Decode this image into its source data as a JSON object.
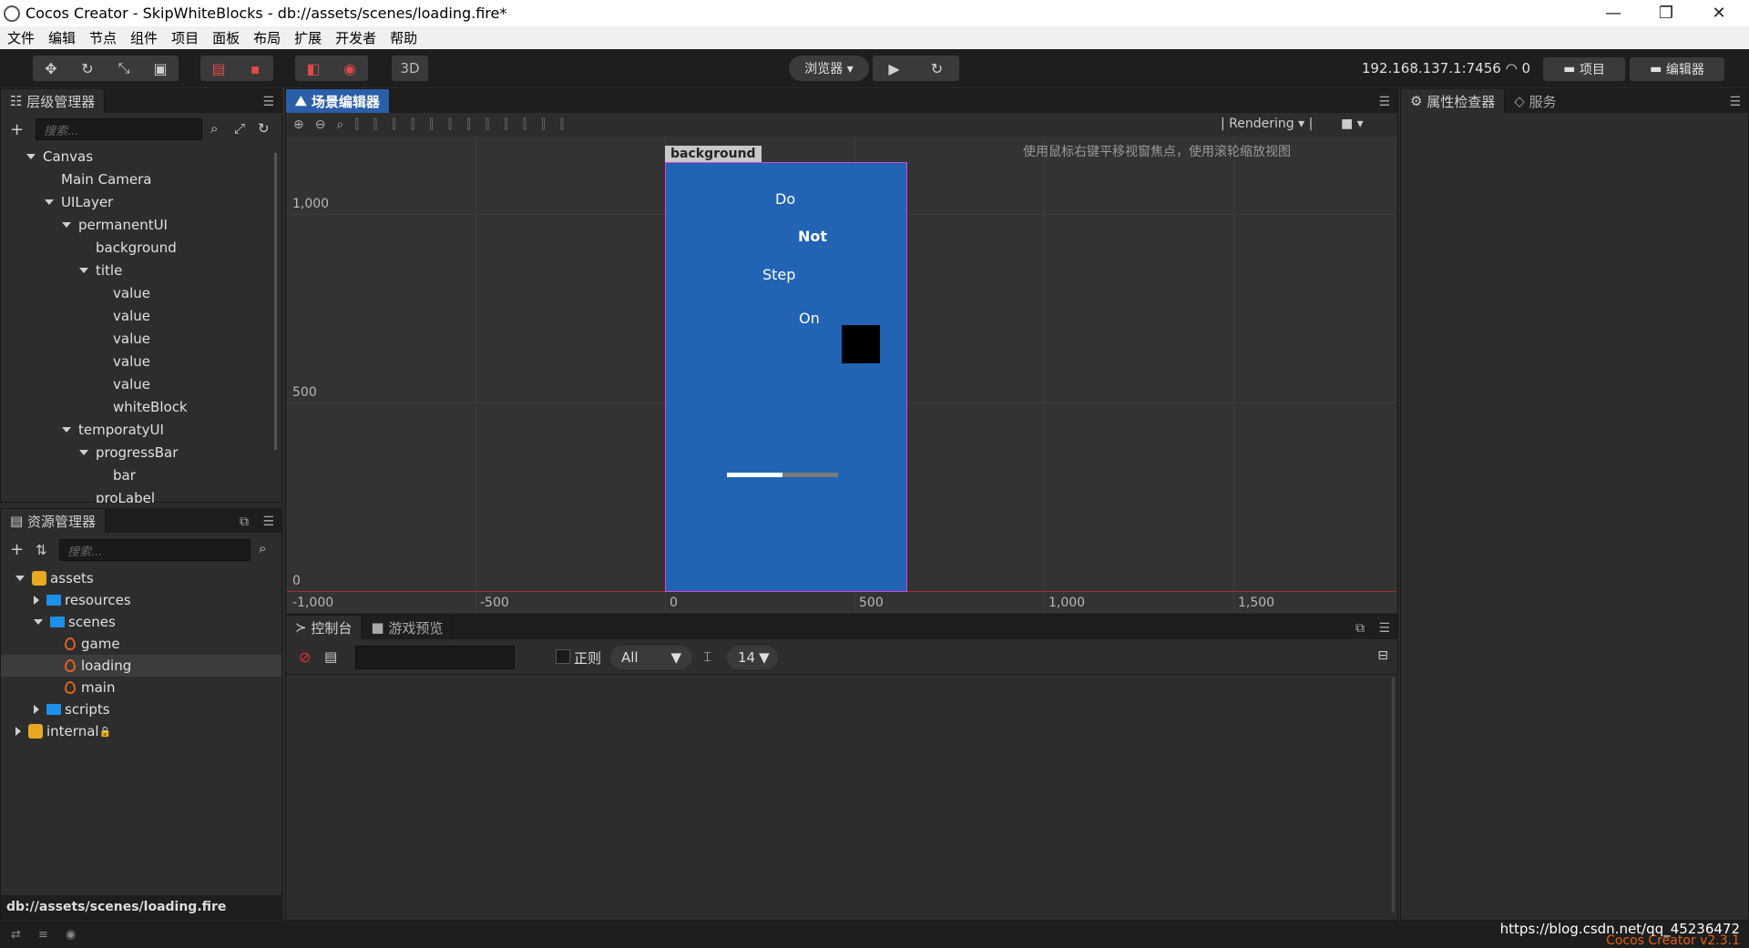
{
  "window": {
    "title": "Cocos Creator - SkipWhiteBlocks - db://assets/scenes/loading.fire*"
  },
  "menu": [
    "文件",
    "编辑",
    "节点",
    "组件",
    "项目",
    "面板",
    "布局",
    "扩展",
    "开发者",
    "帮助"
  ],
  "toolbar": {
    "mode_3d": "3D",
    "browser_label": "浏览器 ▾",
    "ip": "192.168.137.1:7456",
    "wifi_count": "0",
    "project_btn": "项目",
    "editor_btn": "编辑器"
  },
  "hierarchy": {
    "title": "层级管理器",
    "search_placeholder": "搜索...",
    "nodes": [
      {
        "label": "Canvas",
        "arrow": "down"
      },
      {
        "label": "Main Camera",
        "arrow": ""
      },
      {
        "label": "UILayer",
        "arrow": "down"
      },
      {
        "label": "permanentUI",
        "arrow": "down"
      },
      {
        "label": "background",
        "arrow": ""
      },
      {
        "label": "title",
        "arrow": "down"
      },
      {
        "label": "value",
        "arrow": ""
      },
      {
        "label": "value",
        "arrow": ""
      },
      {
        "label": "value",
        "arrow": ""
      },
      {
        "label": "value",
        "arrow": ""
      },
      {
        "label": "value",
        "arrow": ""
      },
      {
        "label": "whiteBlock",
        "arrow": ""
      },
      {
        "label": "temporatyUI",
        "arrow": "down"
      },
      {
        "label": "progressBar",
        "arrow": "down"
      },
      {
        "label": "bar",
        "arrow": ""
      },
      {
        "label": "proLabel",
        "arrow": ""
      }
    ]
  },
  "assets": {
    "title": "资源管理器",
    "search_placeholder": "搜索...",
    "items": [
      {
        "label": "assets",
        "arrow": "down",
        "icon": "db-icon"
      },
      {
        "label": "resources",
        "arrow": "right",
        "icon": "folder-icon"
      },
      {
        "label": "scenes",
        "arrow": "down",
        "icon": "folder-icon"
      },
      {
        "label": "game",
        "arrow": "",
        "icon": "fire-icon"
      },
      {
        "label": "loading",
        "arrow": "",
        "icon": "fire-icon"
      },
      {
        "label": "main",
        "arrow": "",
        "icon": "fire-icon"
      },
      {
        "label": "scripts",
        "arrow": "right",
        "icon": "folder-icon"
      },
      {
        "label": "internal",
        "arrow": "right",
        "icon": "db-icon"
      }
    ],
    "footer_path": "db://assets/scenes/loading.fire"
  },
  "scene": {
    "title": "场景编辑器",
    "rendering": "Rendering",
    "hint": "使用鼠标右键平移视窗焦点，使用滚轮缩放视图",
    "node_label": "background",
    "words": [
      "Do",
      "Not",
      "Step",
      "On"
    ],
    "y_labels": [
      "1,000",
      "500",
      "0"
    ],
    "x_labels": [
      "-1,000",
      "-500",
      "0",
      "500",
      "1,000",
      "1,500"
    ],
    "progress": 0.5
  },
  "console": {
    "tab_console": "控制台",
    "tab_preview": "游戏预览",
    "regex_label": "正则",
    "filter_value": "All",
    "font_size": "14"
  },
  "inspector": {
    "tab_props": "属性检查器",
    "tab_service": "服务"
  },
  "statusbar": {
    "url": "https://blog.csdn.net/qq_45236472",
    "version": "Cocos Creator v2.3.1"
  }
}
